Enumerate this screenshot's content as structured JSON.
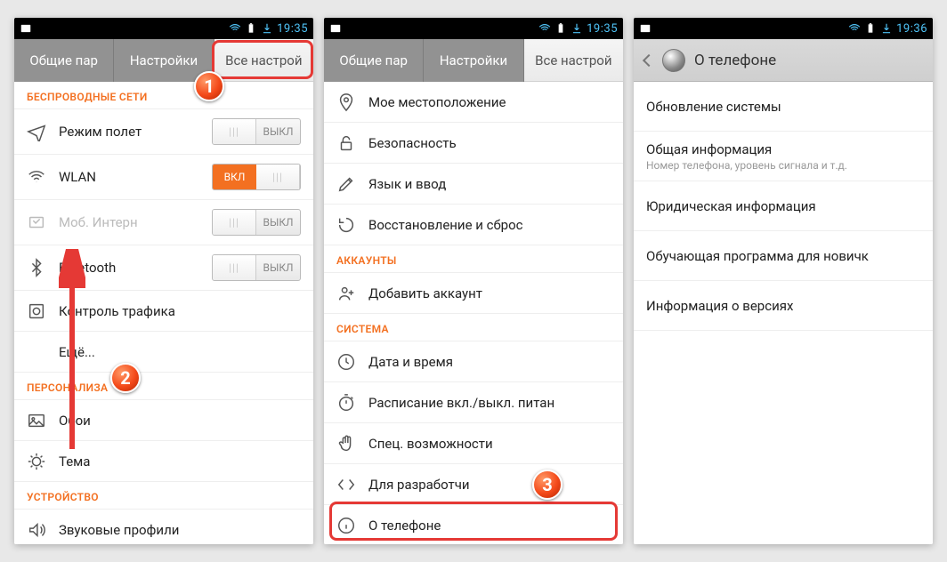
{
  "status": {
    "time1": "19:35",
    "time2": "19:35",
    "time3": "19:36"
  },
  "tabs": {
    "t1": "Общие пар",
    "t2": "Настройки",
    "t3": "Все настрой"
  },
  "p1": {
    "sec_wireless": "БЕСПРОВОДНЫЕ СЕТИ",
    "airplane": "Режим полет",
    "wlan": "WLAN",
    "mob": "Моб. Интерн",
    "bt": "Bluetooth",
    "traffic": "Контроль трафика",
    "more": "Ещё...",
    "sec_personal": "ПЕРСОНАЛИЗА",
    "wallpaper": "Обои",
    "theme": "Тема",
    "sec_device": "УСТРОЙСТВО",
    "sound": "Звуковые профили",
    "toggle_off": "ВЫКЛ",
    "toggle_on": "ВКЛ"
  },
  "p2": {
    "location": "Мое местоположение",
    "security": "Безопасность",
    "lang": "Язык и ввод",
    "reset": "Восстановление и сброс",
    "sec_accounts": "АККАУНТЫ",
    "add_account": "Добавить аккаунт",
    "sec_system": "СИСТЕМА",
    "date": "Дата и время",
    "schedule": "Расписание вкл./выкл. питан",
    "access": "Спец. возможности",
    "dev": "Для разработчи",
    "about": "О телефоне"
  },
  "p3": {
    "title": "О телефоне",
    "update": "Обновление системы",
    "info": "Общая информация",
    "info_sub": "Номер телефона, уровень сигнала и т.д.",
    "legal": "Юридическая информация",
    "tutorial": "Обучающая программа для новичк",
    "version": "Информация о версиях"
  },
  "badges": {
    "n1": "1",
    "n2": "2",
    "n3": "3"
  }
}
